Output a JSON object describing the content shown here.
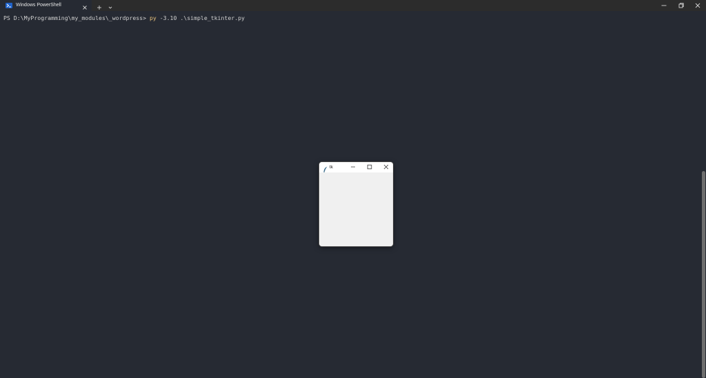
{
  "tab": {
    "title": "Windows PowerShell",
    "icon": "powershell-icon",
    "close_icon": "close-icon"
  },
  "tabbar": {
    "new_tab_icon": "plus-icon",
    "dropdown_icon": "chevron-down-icon"
  },
  "window_controls": [
    "minimize-icon",
    "restore-icon",
    "close-icon"
  ],
  "terminal": {
    "prompt": "PS D:\\MyProgramming\\my_modules\\_wordpress> ",
    "command": "py",
    "args": " -3.10 .\\simple_tkinter.py"
  },
  "tk_window": {
    "title": "tk",
    "icon": "feather-icon",
    "controls": [
      "minimize-icon",
      "maximize-icon",
      "close-icon"
    ]
  },
  "colors": {
    "terminal_bg": "#262a33",
    "titlebar_bg": "#2c2c2c",
    "command_color": "#e6c07b",
    "text_color": "#d0d0d0",
    "tk_body": "#f0f0f0"
  }
}
